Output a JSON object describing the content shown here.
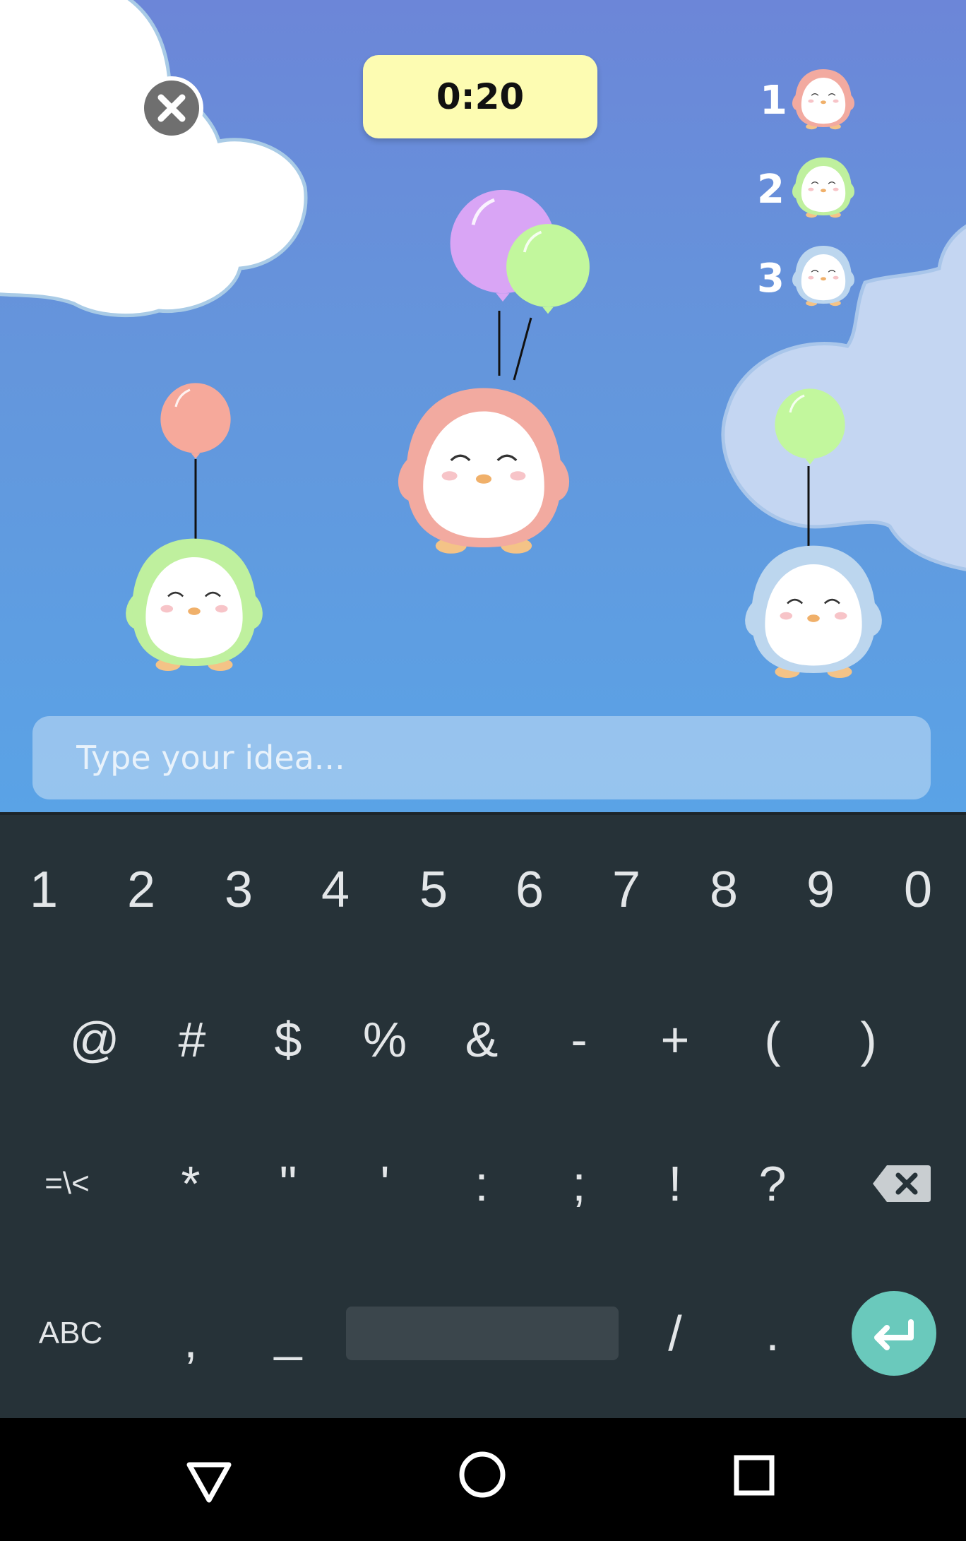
{
  "timer": {
    "value": "0:20"
  },
  "leaderboard": [
    {
      "rank": "1",
      "penguin_color": "#f2aaa0"
    },
    {
      "rank": "2",
      "penguin_color": "#bff09e"
    },
    {
      "rank": "3",
      "penguin_color": "#bcd6ee"
    }
  ],
  "idea_input": {
    "placeholder": "Type your idea...",
    "value": ""
  },
  "keyboard": {
    "row1": [
      "1",
      "2",
      "3",
      "4",
      "5",
      "6",
      "7",
      "8",
      "9",
      "0"
    ],
    "row2": [
      "@",
      "#",
      "$",
      "%",
      "&",
      "-",
      "+",
      "(",
      ")"
    ],
    "row3": [
      "=\\<",
      "*",
      "\"",
      "'",
      ":",
      ";",
      "!",
      "?"
    ],
    "row4": {
      "abc": "ABC",
      "comma": ",",
      "underscore": "_",
      "slash": "/",
      "period": "."
    }
  },
  "colors": {
    "sky_top": "#6c86d8",
    "sky_bottom": "#5aa3e6",
    "timer_bg": "#fdfcb2",
    "keyboard_bg": "#263238",
    "enter_key": "#6ac9bc",
    "balloon_purple": "#d9a5f5",
    "balloon_green": "#c2f79d",
    "balloon_pink": "#f6a99b"
  },
  "icons": {
    "close": "close-circle-icon",
    "backspace": "backspace-icon",
    "enter": "enter-arrow-icon",
    "nav_back": "triangle-back-icon",
    "nav_home": "circle-home-icon",
    "nav_recents": "square-recents-icon"
  }
}
